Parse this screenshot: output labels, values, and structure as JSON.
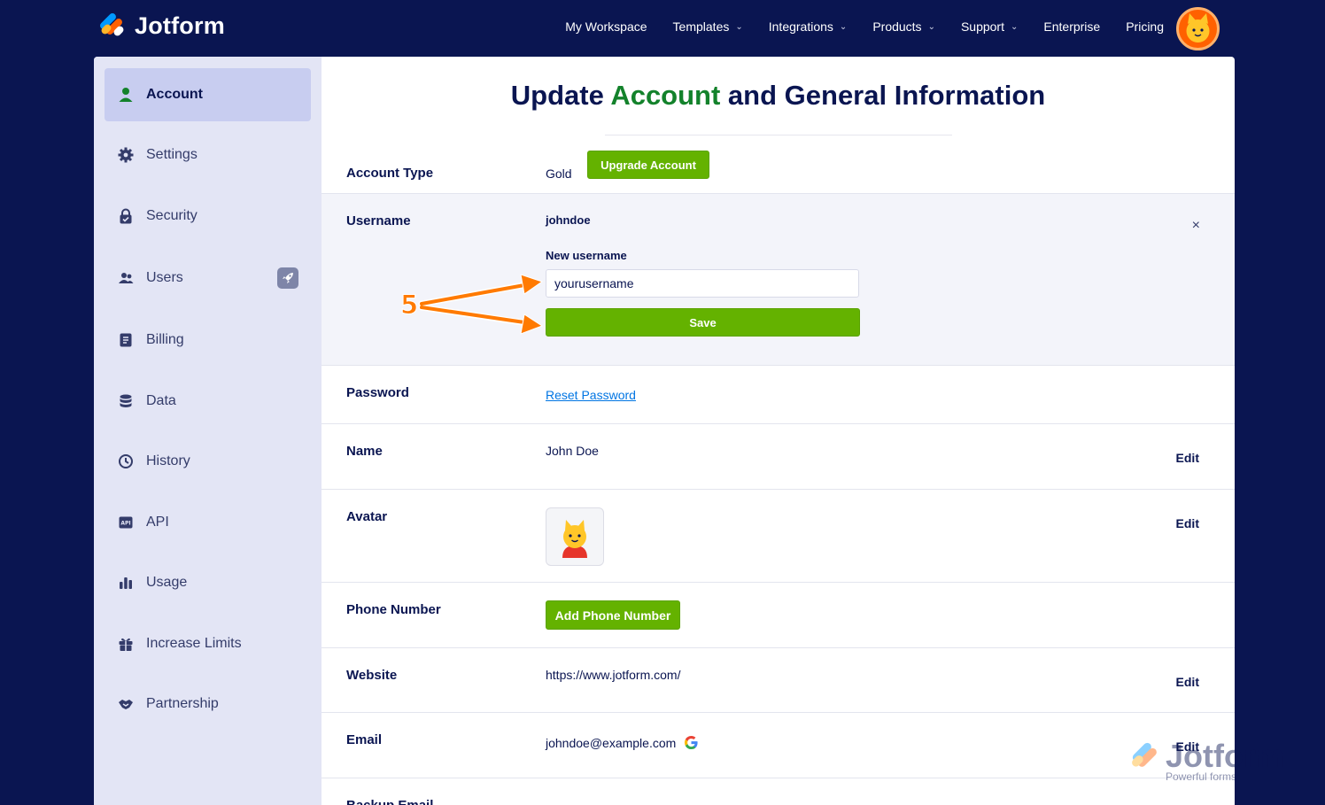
{
  "brand": {
    "name": "Jotform"
  },
  "nav": {
    "items": [
      {
        "label": "My Workspace",
        "has_dropdown": false
      },
      {
        "label": "Templates",
        "has_dropdown": true
      },
      {
        "label": "Integrations",
        "has_dropdown": true
      },
      {
        "label": "Products",
        "has_dropdown": true
      },
      {
        "label": "Support",
        "has_dropdown": true
      },
      {
        "label": "Enterprise",
        "has_dropdown": false
      },
      {
        "label": "Pricing",
        "has_dropdown": false
      }
    ]
  },
  "sidebar": {
    "items": [
      {
        "label": "Account",
        "icon": "user-icon",
        "active": true
      },
      {
        "label": "Settings",
        "icon": "gear-icon"
      },
      {
        "label": "Security",
        "icon": "lock-icon"
      },
      {
        "label": "Users",
        "icon": "users-icon",
        "badge_icon": "rocket-icon"
      },
      {
        "label": "Billing",
        "icon": "billing-icon"
      },
      {
        "label": "Data",
        "icon": "database-icon"
      },
      {
        "label": "History",
        "icon": "history-icon"
      },
      {
        "label": "API",
        "icon": "api-icon"
      },
      {
        "label": "Usage",
        "icon": "bar-chart-icon"
      },
      {
        "label": "Increase Limits",
        "icon": "gift-icon"
      },
      {
        "label": "Partnership",
        "icon": "handshake-icon"
      }
    ]
  },
  "page": {
    "title_part1": "Update ",
    "title_highlight": "Account",
    "title_part2": " and General Information"
  },
  "account_type": {
    "label": "Account Type",
    "value": "Gold",
    "button": "Upgrade Account"
  },
  "username": {
    "label": "Username",
    "value": "johndoe",
    "new_label": "New username",
    "input_value": "yourusername",
    "save_button": "Save",
    "close_glyph": "×"
  },
  "password": {
    "label": "Password",
    "link": "Reset Password"
  },
  "name": {
    "label": "Name",
    "value": "John Doe",
    "edit": "Edit"
  },
  "avatar": {
    "label": "Avatar",
    "edit": "Edit"
  },
  "phone": {
    "label": "Phone Number",
    "button": "Add Phone Number"
  },
  "website": {
    "label": "Website",
    "value": "https://www.jotform.com/",
    "edit": "Edit"
  },
  "email": {
    "label": "Email",
    "value": "johndoe@example.com",
    "edit": "Edit",
    "provider_icon": "google-icon"
  },
  "backup_email": {
    "label": "Backup Email"
  },
  "annotation": {
    "step": "5"
  },
  "watermark": {
    "name": "Jotform",
    "tagline": "Powerful forms"
  },
  "colors": {
    "navy": "#0a1551",
    "green": "#64b200",
    "title_green": "#13822b",
    "orange": "#ff7a00",
    "sidebar": "#e3e5f5"
  }
}
